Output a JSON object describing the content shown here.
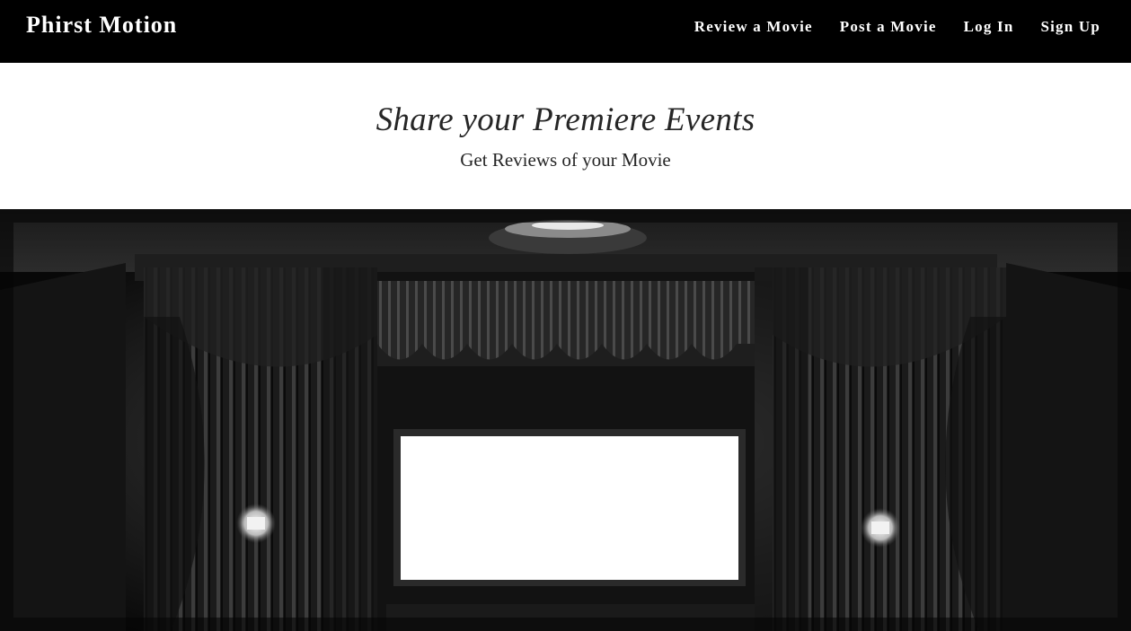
{
  "nav": {
    "brand": "Phirst Motion",
    "links": [
      "Review a Movie",
      "Post a Movie",
      "Log In",
      "Sign Up"
    ]
  },
  "hero": {
    "title": "Share your Premiere Events",
    "subtitle": "Get Reviews of your Movie"
  },
  "colors": {
    "navbar_bg": "#000000",
    "nav_text": "#ffffff",
    "hero_text": "#262626",
    "page_bg": "#ffffff"
  },
  "image": {
    "subject": "theater-stage-photo"
  }
}
